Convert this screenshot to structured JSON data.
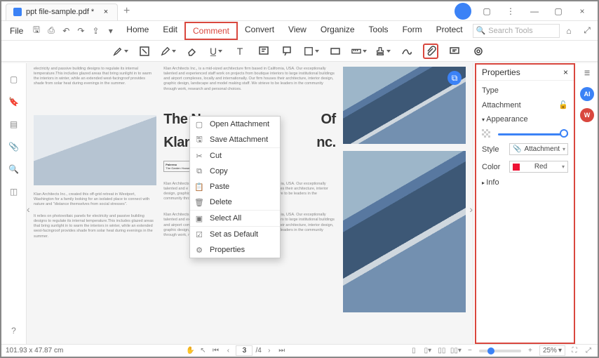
{
  "titlebar": {
    "tab_title": "ppt file-sample.pdf *"
  },
  "menus": {
    "file": "File",
    "tabs": [
      "Home",
      "Edit",
      "Comment",
      "Convert",
      "View",
      "Organize",
      "Tools",
      "Form",
      "Protect"
    ],
    "active": "Comment",
    "search_placeholder": "Search Tools"
  },
  "doc": {
    "heading1": "The N",
    "heading2": "Klan A",
    "heading_mid": "Of",
    "heading_end": "nc.",
    "logo_name": "The Garden House Archiplex",
    "paraA": "electricity and passive building designs to regulate its internal temperature.This includes glazed areas that bring sunlight in to warm the interiors in winter, while an extended west-facingroof provides shade from solar heat during evenings in the summer.",
    "paraA2": "Klan Architects Inc., created this off-grid retreat in Westport, Washington for a family looking for an isolated place to connect with nature and \"distance themselves from social stresses\".",
    "paraA3": "It relies on photovoltaic panels for electricity and passive building designs to regulate its internal temperature.This includes glazed areas that bring sunlight in to warm the interiors in winter, while an extended west-facingroof provides shade from solar heat during evenings in the summer.",
    "paraB": "Klan Architects Inc., is a mid-sized architecture firm based in California, USA. Our exceptionally talented and experienced staff work on projects from boutique interiors to large institutional buildings and airport complexes, locally and internationally. Our firm houses their architecture, interior design, graphic design, landscape and model making staff. We strieve to be leaders in the community through work, research and personal choices.",
    "paraC": "Klan Architects Inc., is a mid-sized architecture firm based in California, USA. Our exceptionally talented and e                                                                                    nteriors to large institutional buildings a                                                                                     Our firm houses their architecture, interior design, graphic design, landscape and model making staff. We strieve to be leaders in the community through work, research and personal choices.",
    "paraD": "Klan Architects Inc., is a mid-sized architecture firm based in California, USA. Our exceptionally talented and experienced staff work on projects from boutique interiors to large institutional buildings and airport complexes, locally and internationally. Our firm houses their architecture, interior design, graphic design, landscape and model making staff. We strieve to be leaders in the community through work, research and personal choices."
  },
  "context": {
    "items": [
      "Open Attachment",
      "Save Attachment",
      "Cut",
      "Copy",
      "Paste",
      "Delete",
      "Select All",
      "Set as Default",
      "Properties"
    ]
  },
  "properties": {
    "title": "Properties",
    "type_label": "Type",
    "type_value": "Attachment",
    "appearance": "Appearance",
    "opacity_label": "",
    "style_label": "Style",
    "style_value": "Attachment",
    "color_label": "Color",
    "color_value": "Red",
    "info_label": "Info"
  },
  "status": {
    "coords": "101.93 x 47.87 cm",
    "page_current": "3",
    "page_total": "/4",
    "zoom": "25%"
  }
}
